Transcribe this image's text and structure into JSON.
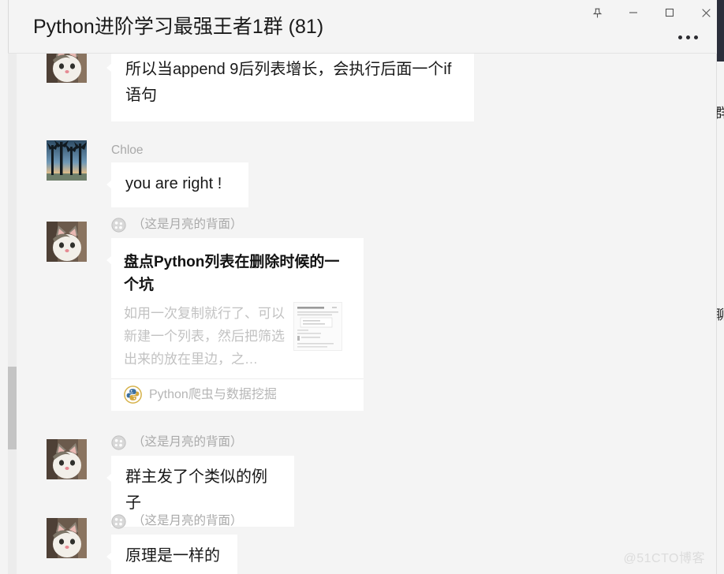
{
  "window": {
    "title": "Python进阶学习最强王者1群 (81)",
    "controls": {
      "pin": "pin-window",
      "minimize": "minimize",
      "maximize": "maximize",
      "close": "close"
    },
    "more_label": "更多"
  },
  "watermark": "@51CTO博客",
  "right_panel_clip": {
    "line1": "群",
    "line2": "聊"
  },
  "messages": [
    {
      "id": "msg-append",
      "sender": "",
      "sender_badge": "",
      "type": "text",
      "text": "所以当append 9后列表增长，会执行后面一个if语句"
    },
    {
      "id": "msg-chloe",
      "sender": "Chloe",
      "sender_badge": "",
      "type": "text",
      "text": "you are right !"
    },
    {
      "id": "msg-card",
      "sender": "（这是月亮的背面）",
      "sender_badge": "group-badge-icon",
      "type": "card",
      "card": {
        "title": "盘点Python列表在删除时候的一个坑",
        "description": "如用一次复制就行了、可以新建一个列表，然后把筛选出来的放在里边，之…",
        "source": "Python爬虫与数据挖掘",
        "source_icon": "python-logo-icon",
        "thumbnail": "article-screenshot-thumbnail"
      }
    },
    {
      "id": "msg-example",
      "sender": "（这是月亮的背面）",
      "sender_badge": "group-badge-icon",
      "type": "text",
      "text": "群主发了个类似的例子"
    },
    {
      "id": "msg-principle",
      "sender": "（这是月亮的背面）",
      "sender_badge": "group-badge-icon",
      "type": "text",
      "text": "原理是一样的"
    }
  ],
  "colors": {
    "app_background": "#f4f4f4",
    "bubble": "#ffffff",
    "text_primary": "#181818",
    "text_muted": "#a9a9a9",
    "accent_dark": "#2b2e3b",
    "scrollbar_thumb": "#c4c4c4"
  }
}
